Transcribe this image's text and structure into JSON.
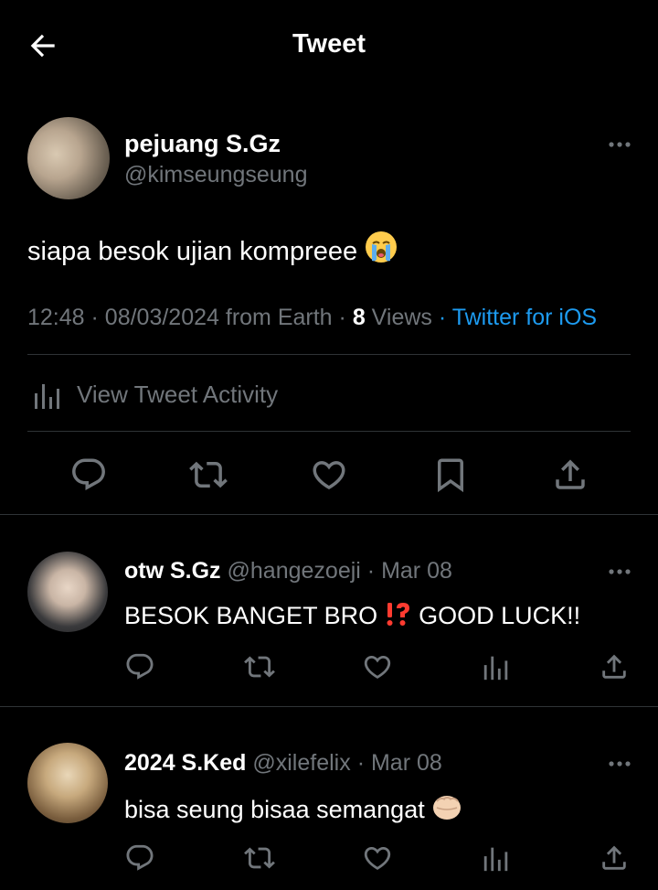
{
  "header": {
    "title": "Tweet",
    "back_icon": "arrow-left-icon"
  },
  "tweet": {
    "display_name": "pejuang S.Gz",
    "handle": "@kimseungseung",
    "text": "siapa besok ujian kompreee",
    "text_emoji": "loudly-crying-face-emoji",
    "time": "12:48",
    "date": "08/03/2024",
    "location": "from Earth",
    "views_count": "8",
    "views_label": "Views",
    "source": "Twitter for iOS",
    "activity_label": "View Tweet Activity",
    "actions": [
      "reply-icon",
      "retweet-icon",
      "like-icon",
      "bookmark-icon",
      "share-icon"
    ]
  },
  "replies": [
    {
      "display_name": "otw S.Gz",
      "handle": "@hangezoeji",
      "date": "Mar 08",
      "text_before": "BESOK BANGET BRO",
      "emoji": "double-exclamation-question-emoji",
      "text_after": "GOOD LUCK!!"
    },
    {
      "display_name": "2024 S.Ked",
      "handle": "@xilefelix",
      "date": "Mar 08",
      "text_before": "bisa seung bisaa semangat",
      "emoji": "oncoming-fist-emoji",
      "text_after": ""
    }
  ],
  "colors": {
    "background": "#000000",
    "text": "#e7e9ea",
    "secondary": "#71767b",
    "accent": "#1d9bf0",
    "divider": "#2f3336"
  }
}
